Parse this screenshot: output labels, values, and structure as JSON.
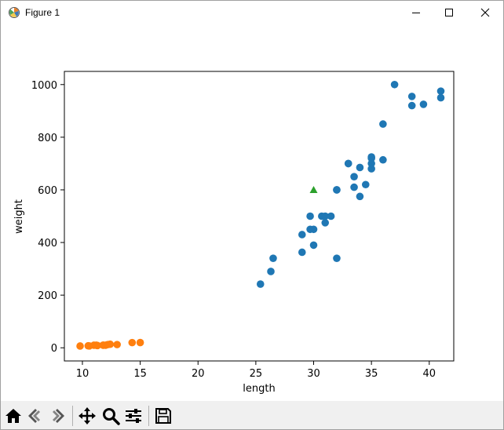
{
  "window": {
    "title": "Figure 1",
    "icon": "matplotlib-icon",
    "controls": [
      "minimize-icon",
      "maximize-icon",
      "close-icon"
    ]
  },
  "toolbar": {
    "items": [
      "home-icon",
      "back-icon",
      "forward-icon",
      "pan-icon",
      "zoom-icon",
      "subplots-icon",
      "save-icon"
    ]
  },
  "chart_data": {
    "type": "scatter",
    "xlabel": "length",
    "ylabel": "weight",
    "xlim": [
      8.44,
      20.0
    ],
    "ylim": [
      -50,
      1000
    ],
    "xticks": [
      10,
      15,
      20,
      25,
      30,
      35,
      40
    ],
    "yticks": [
      0,
      200,
      400,
      600,
      800,
      1000
    ],
    "grid": false,
    "series": [
      {
        "marker": "circle",
        "color": "#1f77b4",
        "points": [
          [
            25.4,
            242
          ],
          [
            26.3,
            290
          ],
          [
            26.5,
            340
          ],
          [
            29.0,
            363
          ],
          [
            29.0,
            430
          ],
          [
            29.7,
            450
          ],
          [
            29.7,
            500
          ],
          [
            30.0,
            390
          ],
          [
            30.0,
            450
          ],
          [
            30.7,
            500
          ],
          [
            31.0,
            475
          ],
          [
            31.0,
            500
          ],
          [
            31.5,
            500
          ],
          [
            32.0,
            340
          ],
          [
            32.0,
            600
          ],
          [
            32.0,
            600
          ],
          [
            33.0,
            700
          ],
          [
            33.0,
            700
          ],
          [
            33.5,
            610
          ],
          [
            33.5,
            650
          ],
          [
            34.0,
            575
          ],
          [
            34.0,
            685
          ],
          [
            34.5,
            620
          ],
          [
            35.0,
            680
          ],
          [
            35.0,
            700
          ],
          [
            35.0,
            725
          ],
          [
            35.0,
            720
          ],
          [
            36.0,
            714
          ],
          [
            36.0,
            850
          ],
          [
            37.0,
            1000
          ],
          [
            38.5,
            920
          ],
          [
            38.5,
            955
          ],
          [
            39.5,
            925
          ],
          [
            41.0,
            975
          ],
          [
            41.0,
            950
          ]
        ]
      },
      {
        "marker": "circle",
        "color": "#ff7f0e",
        "points": [
          [
            9.8,
            6.7
          ],
          [
            10.5,
            7.5
          ],
          [
            10.6,
            7.0
          ],
          [
            11.0,
            9.7
          ],
          [
            11.2,
            9.8
          ],
          [
            11.3,
            8.7
          ],
          [
            11.8,
            10.0
          ],
          [
            11.8,
            9.9
          ],
          [
            12.0,
            9.8
          ],
          [
            12.2,
            12.2
          ],
          [
            12.4,
            13.4
          ],
          [
            13.0,
            12.2
          ],
          [
            14.3,
            19.7
          ],
          [
            15.0,
            19.9
          ]
        ]
      },
      {
        "marker": "triangle",
        "color": "#2ca02c",
        "points": [
          [
            30,
            600
          ]
        ]
      }
    ]
  }
}
